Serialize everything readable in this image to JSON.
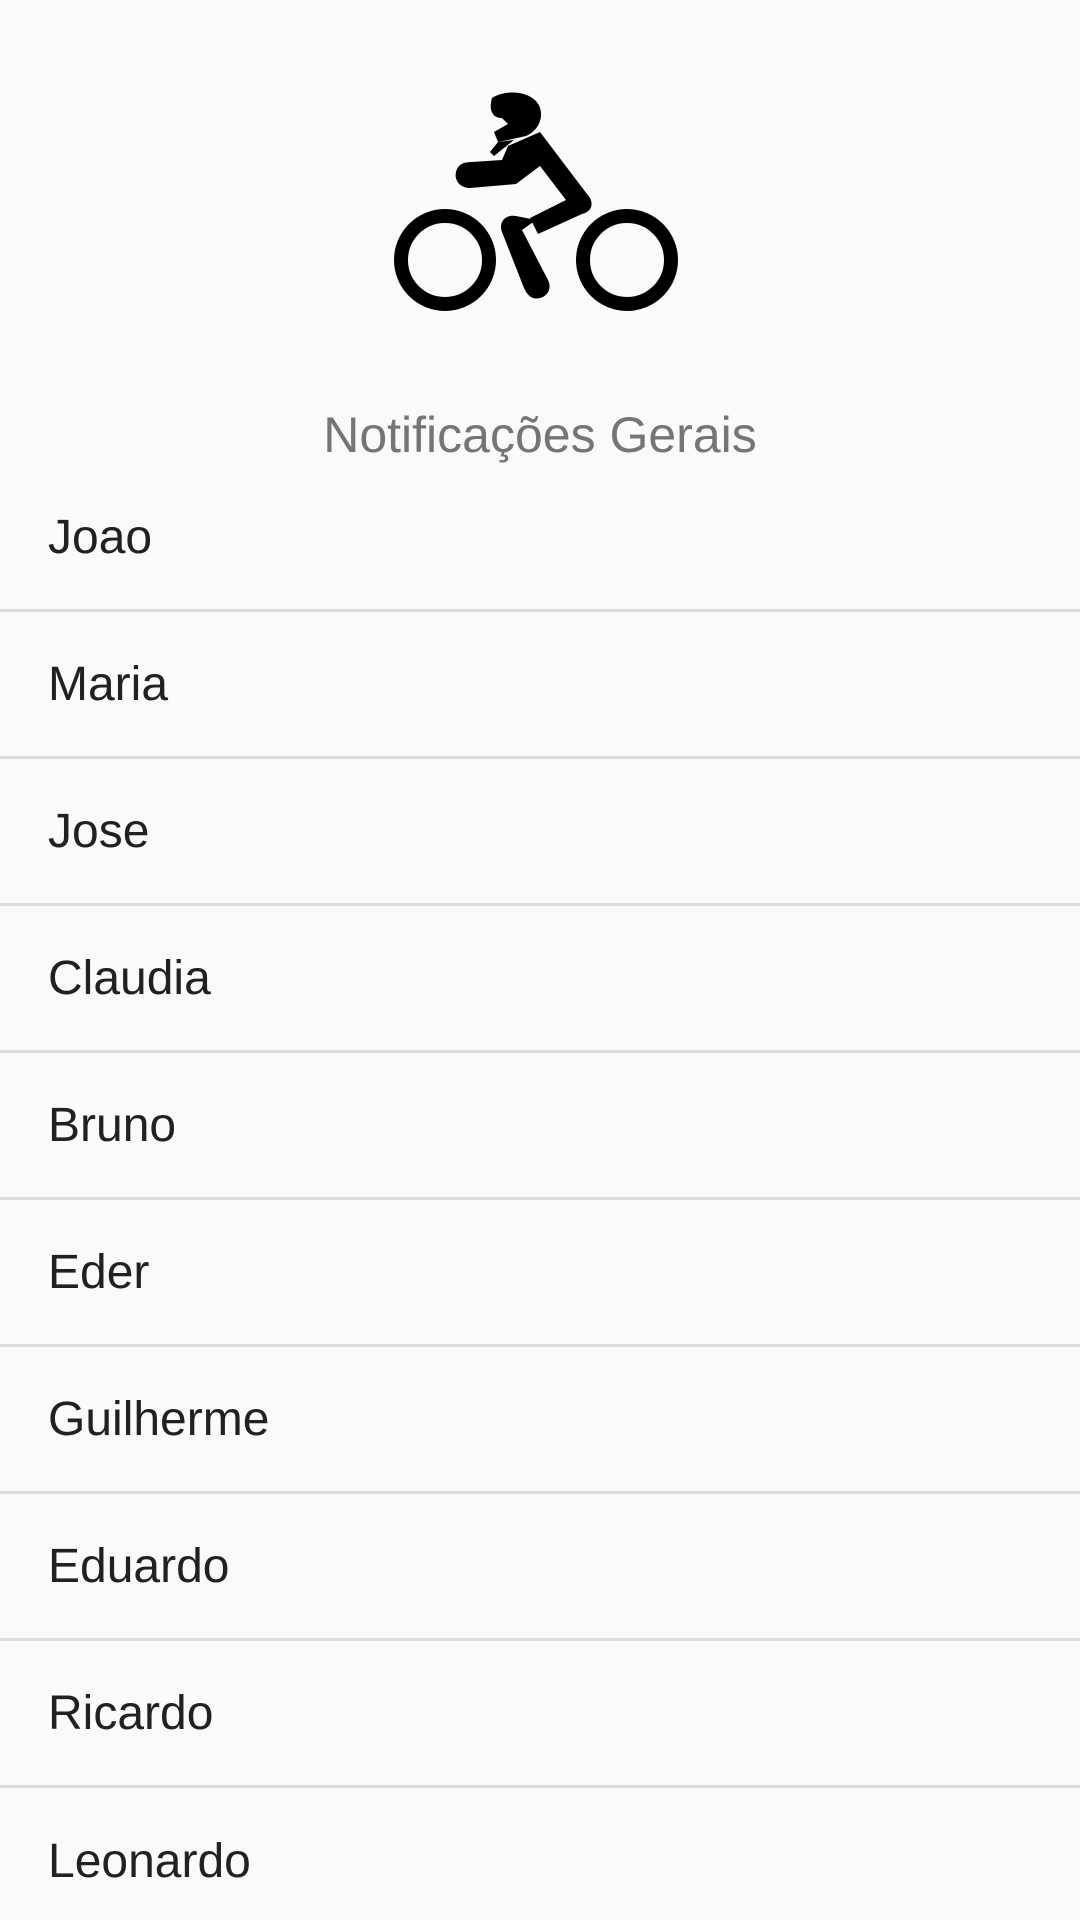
{
  "header": {
    "icon": "motorcycle-rider-icon",
    "title": "Notificações Gerais"
  },
  "list": {
    "items": [
      {
        "label": "Joao"
      },
      {
        "label": "Maria"
      },
      {
        "label": "Jose"
      },
      {
        "label": "Claudia"
      },
      {
        "label": "Bruno"
      },
      {
        "label": "Eder"
      },
      {
        "label": "Guilherme"
      },
      {
        "label": "Eduardo"
      },
      {
        "label": "Ricardo"
      },
      {
        "label": "Leonardo"
      }
    ]
  },
  "colors": {
    "background": "#fafafa",
    "title_text": "#757575",
    "item_text": "#212121",
    "divider": "#dcdcdc",
    "icon": "#000000"
  }
}
